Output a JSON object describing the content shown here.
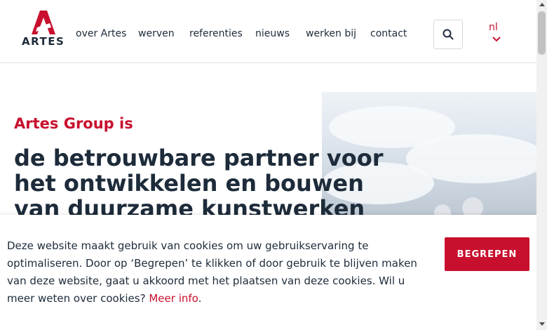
{
  "brand": {
    "name": "ARTES",
    "accent_color": "#c8102e",
    "text_color": "#1d2b3a"
  },
  "nav": {
    "items": [
      {
        "label": "over Artes"
      },
      {
        "label": "werven"
      },
      {
        "label": "referenties"
      },
      {
        "label": "nieuws"
      },
      {
        "label": "werken bij"
      },
      {
        "label": "contact"
      }
    ],
    "search_icon": "search-icon",
    "language": "nl",
    "language_icon": "chevron-down-icon"
  },
  "hero": {
    "kicker": "Artes Group is",
    "title": "de betrouwbare partner voor het ontwikkelen en bouwen van duurzame kunstwerken"
  },
  "cookie": {
    "text": "Deze website maakt gebruik van cookies om uw gebruikservaring te optimaliseren. Door op ‘Begrepen’ te klikken of door gebruik te blijven maken van deze website, gaat u akkoord met het plaatsen van deze cookies. Wil u meer weten over cookies?",
    "link_label": "Meer info",
    "link_suffix": ".",
    "button_label": "BEGREPEN"
  }
}
